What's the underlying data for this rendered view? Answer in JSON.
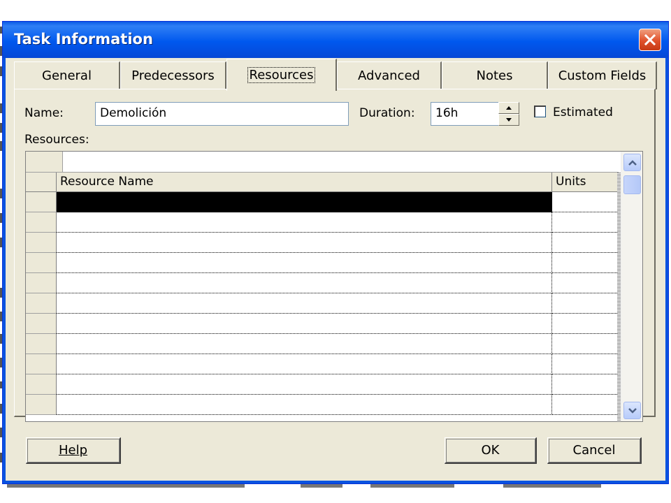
{
  "dialog": {
    "title": "Task Information"
  },
  "tabs": [
    {
      "label": "General",
      "active": false
    },
    {
      "label": "Predecessors",
      "active": false
    },
    {
      "label": "Resources",
      "active": true
    },
    {
      "label": "Advanced",
      "active": false
    },
    {
      "label": "Notes",
      "active": false
    },
    {
      "label": "Custom Fields",
      "active": false
    }
  ],
  "form": {
    "name_label": "Name:",
    "name_value": "Demolición",
    "duration_label": "Duration:",
    "duration_value": "16h",
    "estimated_label": "Estimated",
    "estimated_checked": false,
    "resources_label": "Resources:"
  },
  "grid": {
    "columns": [
      "Resource Name",
      "Units"
    ],
    "rows": [
      {
        "resource_name": "",
        "units": "",
        "selected": true
      },
      {
        "resource_name": "",
        "units": ""
      },
      {
        "resource_name": "",
        "units": ""
      },
      {
        "resource_name": "",
        "units": ""
      },
      {
        "resource_name": "",
        "units": ""
      },
      {
        "resource_name": "",
        "units": ""
      },
      {
        "resource_name": "",
        "units": ""
      },
      {
        "resource_name": "",
        "units": ""
      },
      {
        "resource_name": "",
        "units": ""
      },
      {
        "resource_name": "",
        "units": ""
      },
      {
        "resource_name": "",
        "units": ""
      }
    ]
  },
  "buttons": {
    "help": "Help",
    "ok": "OK",
    "cancel": "Cancel"
  },
  "colors": {
    "titlebar": "#0058ee",
    "dialog_bg": "#ece9d8",
    "close_button": "#e0512b",
    "selection": "#000000"
  }
}
